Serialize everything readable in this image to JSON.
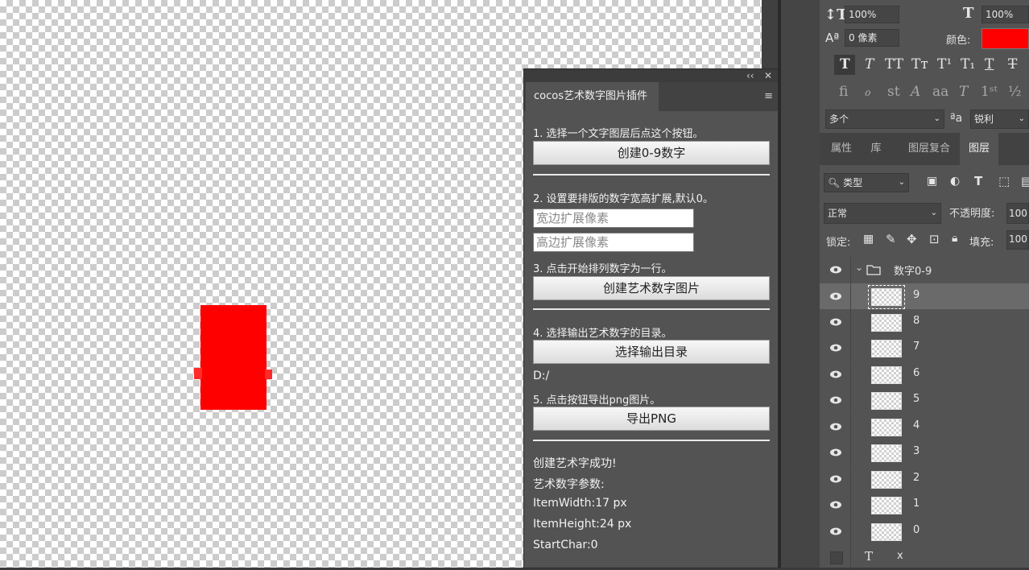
{
  "plugin": {
    "tab_title": "cocos艺术数字图片插件",
    "collapse_glyph": "‹‹",
    "close_glyph": "✕",
    "menu_glyph": "≡",
    "step1": "1. 选择一个文字图层后点这个按钮。",
    "btn_create_digits": "创建0-9数字",
    "step2": "2. 设置要排版的数字宽高扩展,默认0。",
    "width_placeholder": "宽边扩展像素",
    "height_placeholder": "高边扩展像素",
    "step3": "3. 点击开始排列数字为一行。",
    "btn_create_image": "创建艺术数字图片",
    "step4": "4. 选择输出艺术数字的目录。",
    "btn_select_dir": "选择输出目录",
    "output_dir": "D:/",
    "step5": "5. 点击按钮导出png图片。",
    "btn_export": "导出PNG",
    "log": [
      "创建艺术字成功!",
      "艺术数字参数:",
      "ItemWidth:17 px",
      "ItemHeight:24 px",
      "StartChar:0"
    ]
  },
  "character": {
    "vscale": "100%",
    "hscale": "100%",
    "baseline": "0 像素",
    "color_label": "颜色:",
    "color": "#ff0000",
    "font_style": "多个",
    "aa_label": "ªa",
    "antialias": "锐利"
  },
  "panel_tabs": [
    "属性",
    "库",
    "图层复合",
    "图层"
  ],
  "layers": {
    "filter": "类型",
    "blend_mode": "正常",
    "opacity_label": "不透明度:",
    "opacity": "100",
    "lock_label": "锁定:",
    "fill_label": "填充:",
    "fill": "100",
    "group_name": "数字0-9",
    "items": [
      "9",
      "8",
      "7",
      "6",
      "5",
      "4",
      "3",
      "2",
      "1",
      "0"
    ],
    "bottom_layer": "x"
  }
}
